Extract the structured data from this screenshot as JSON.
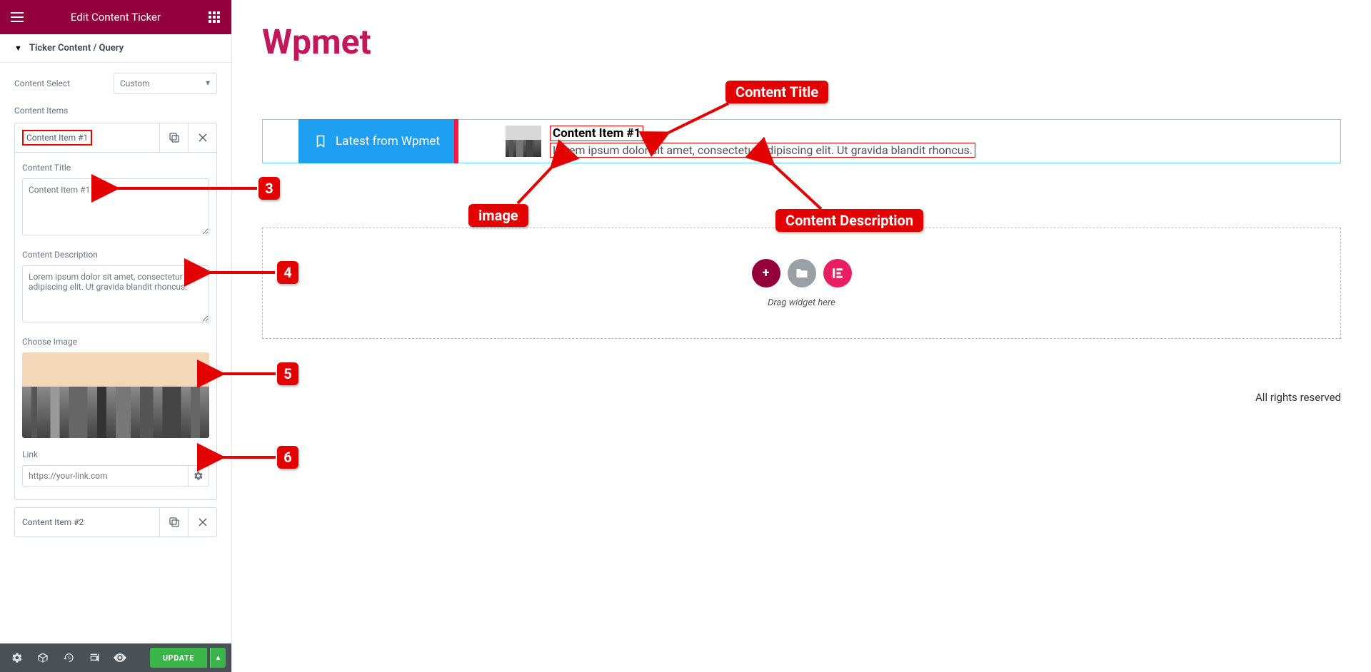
{
  "sidebar": {
    "header_title": "Edit Content Ticker",
    "section_title": "Ticker Content / Query",
    "content_select_label": "Content Select",
    "content_select_value": "Custom",
    "content_items_label": "Content Items",
    "item1_title": "Content Item #1",
    "item2_title": "Content Item #2",
    "content_title_label": "Content Title",
    "content_title_value": "Content Item #1",
    "content_desc_label": "Content Description",
    "content_desc_value": "Lorem ipsum dolor sit amet, consectetur adipiscing elit. Ut gravida blandit rhoncus.",
    "choose_image_label": "Choose Image",
    "link_label": "Link",
    "link_placeholder": "https://your-link.com",
    "update_button": "UPDATE"
  },
  "canvas": {
    "brand": "Wpmet",
    "ticker_tag": "Latest from Wpmet",
    "content_title": "Content Item #1",
    "content_desc": "Lorem ipsum dolor sit amet, consectetur adipiscing elit. Ut gravida blandit rhoncus.",
    "drop_text": "Drag widget here",
    "footer_text": "All rights reserved"
  },
  "annotations": {
    "n3": "3",
    "n4": "4",
    "n5": "5",
    "n6": "6",
    "content_title": "Content Title",
    "image": "image",
    "content_desc": "Content Description"
  }
}
